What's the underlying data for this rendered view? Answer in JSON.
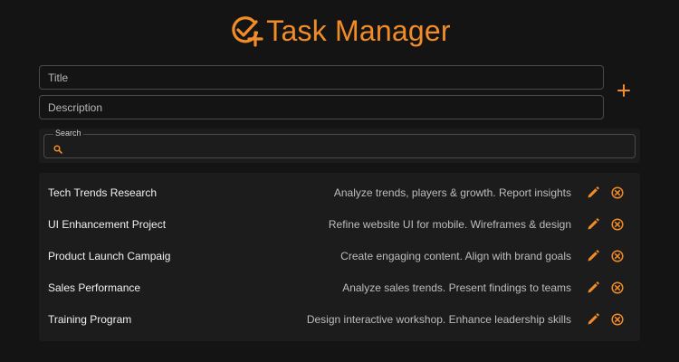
{
  "header": {
    "title": "Task Manager",
    "icon": "task-check-plus-icon"
  },
  "form": {
    "title_placeholder": "Title",
    "description_placeholder": "Description",
    "add_icon": "plus-icon"
  },
  "search": {
    "label": "Search",
    "icon": "search-icon",
    "value": ""
  },
  "tasks": [
    {
      "title": "Tech Trends Research",
      "description": "Analyze trends, players & growth. Report insights"
    },
    {
      "title": "UI Enhancement Project",
      "description": "Refine website UI for mobile. Wireframes & design"
    },
    {
      "title": "Product Launch Campaig",
      "description": "Create engaging content. Align with brand goals"
    },
    {
      "title": "Sales Performance",
      "description": "Analyze sales trends. Present findings to teams"
    },
    {
      "title": "Training Program",
      "description": "Design interactive workshop. Enhance leadership skills"
    }
  ],
  "row_icons": {
    "edit": "pencil-icon",
    "delete": "circle-x-icon"
  },
  "colors": {
    "accent": "#f28c28",
    "background": "#141414",
    "panel": "#1c1c1c",
    "border": "#4a4a4a"
  }
}
